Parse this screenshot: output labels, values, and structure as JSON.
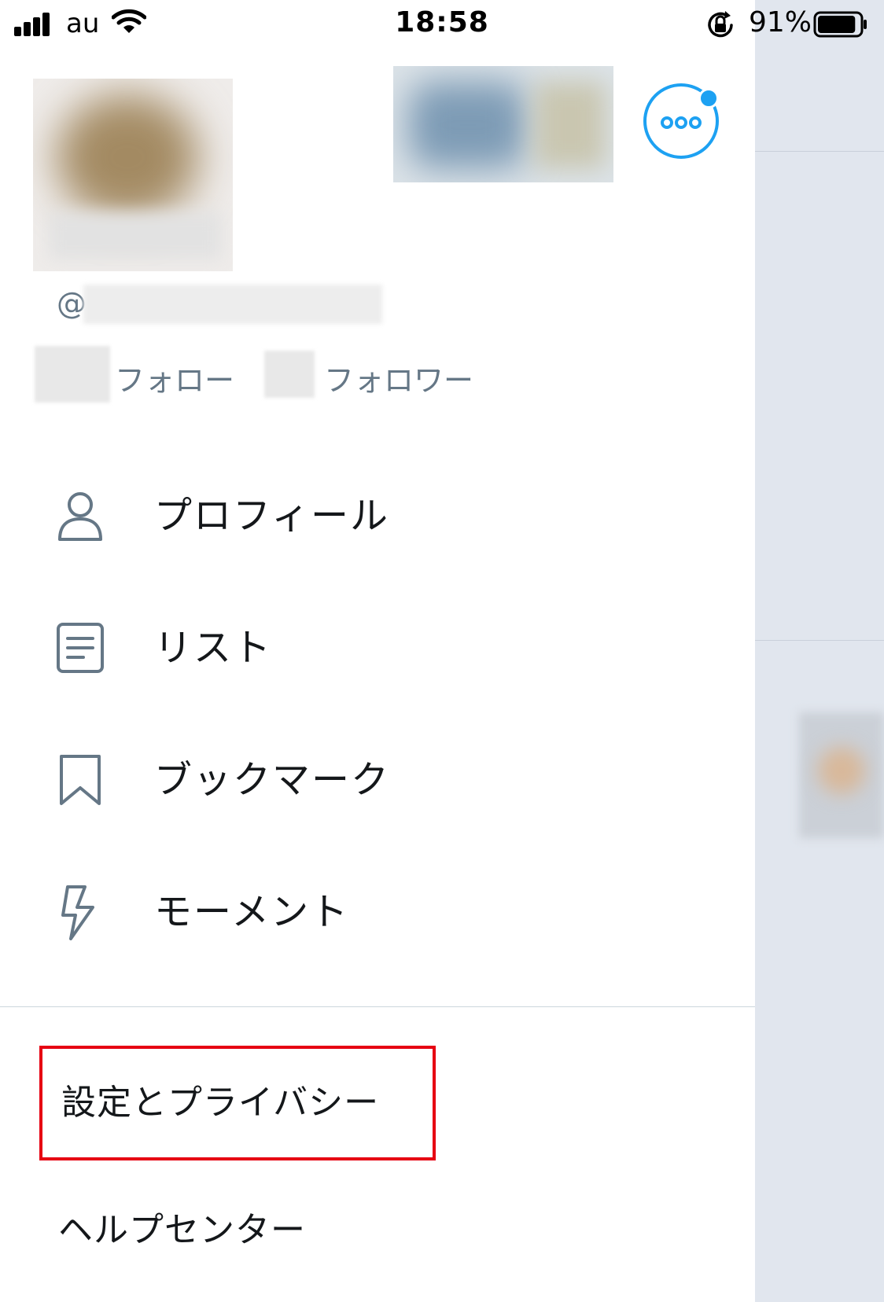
{
  "status_bar": {
    "carrier": "au",
    "time": "18:58",
    "battery_percent": "91%",
    "battery_level": 0.91
  },
  "profile": {
    "handle_prefix": "@",
    "following_label": "フォロー",
    "followers_label": "フォロワー"
  },
  "menu": {
    "items": [
      {
        "label": "プロフィール",
        "icon": "person-icon"
      },
      {
        "label": "リスト",
        "icon": "list-icon"
      },
      {
        "label": "ブックマーク",
        "icon": "bookmark-icon"
      },
      {
        "label": "モーメント",
        "icon": "lightning-icon"
      }
    ],
    "settings_label": "設定とプライバシー",
    "help_label": "ヘルプセンター"
  },
  "colors": {
    "accent": "#1da1f2",
    "icon_gray": "#657786",
    "highlight_box": "#e60012",
    "background_panel": "#e1e6ee"
  }
}
